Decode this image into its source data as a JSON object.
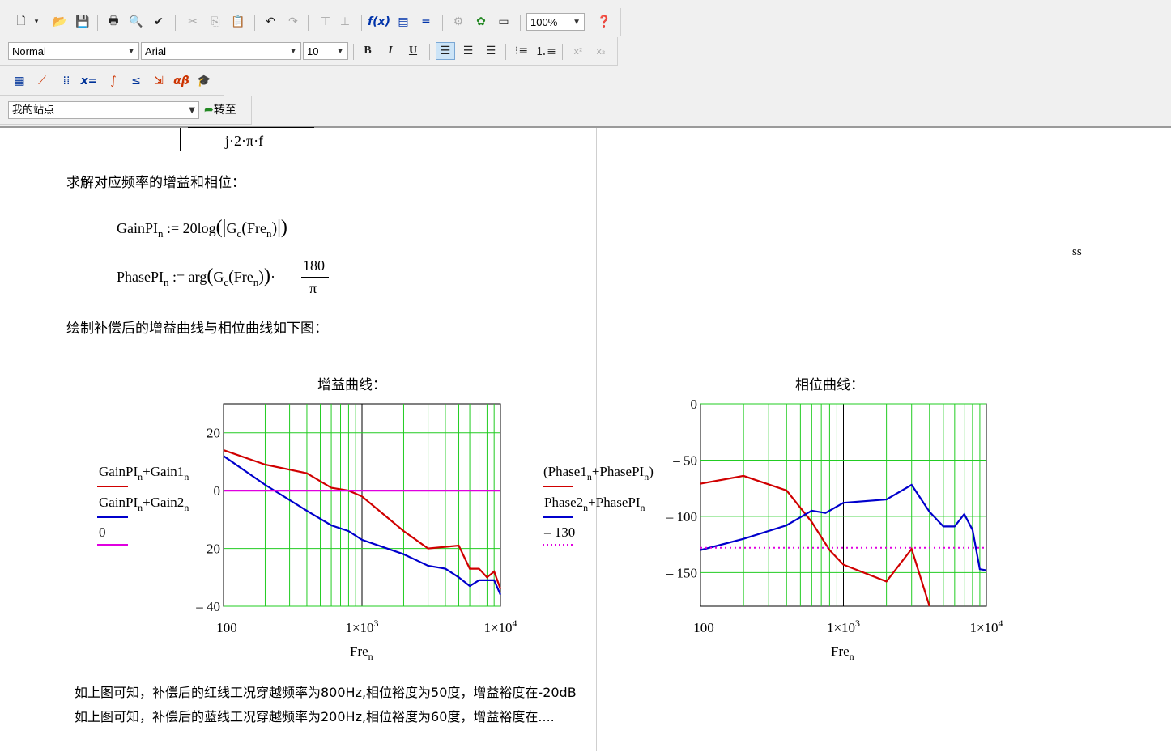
{
  "toolbar": {
    "zoom": "100%",
    "style": "Normal",
    "font": "Arial",
    "size": "10",
    "bold": "B",
    "italic": "I",
    "underline": "U",
    "sites": "我的站点",
    "goto": "转至"
  },
  "doc": {
    "fraction_den": "j·2·π·f",
    "heading1": "求解对应频率的增益和相位：",
    "eq1_lhs": "GainPI",
    "eq1_rhs": "20log",
    "eq1_fn": "G",
    "eq1_arg": "Fre",
    "eq2_lhs": "PhasePI",
    "eq2_rhs": "arg",
    "eq2_num": "180",
    "eq2_den": "π",
    "heading2": "绘制补偿后的增益曲线与相位曲线如下图：",
    "stray": "ss",
    "conclusion1": "如上图可知，补偿后的红线工况穿越频率为800Hz,相位裕度为50度，增益裕度在-20dB",
    "conclusion2": "如上图可知，补偿后的蓝线工况穿越频率为200Hz,相位裕度为60度，增益裕度在...."
  },
  "chart_data": [
    {
      "type": "line",
      "title": "增益曲线：",
      "xlabel": "Fre",
      "xscale": "log",
      "xlim": [
        100,
        10000
      ],
      "ylim": [
        -40,
        30
      ],
      "yticks": [
        "20",
        "0",
        "– 20",
        "– 40"
      ],
      "xticks": [
        "100",
        "1×10",
        "1×10"
      ],
      "xtick_exp": [
        "",
        "3",
        "4"
      ],
      "series": [
        {
          "name": "GainPI+Gain1",
          "color": "#d00000",
          "x": [
            100,
            200,
            400,
            600,
            800,
            1000,
            2000,
            3000,
            5000,
            6000,
            7000,
            8000,
            9000,
            10000
          ],
          "y": [
            14,
            9,
            6,
            1,
            0,
            -2,
            -14,
            -20,
            -19,
            -27,
            -27,
            -30,
            -28,
            -34
          ]
        },
        {
          "name": "GainPI+Gain2",
          "color": "#0000cc",
          "x": [
            100,
            200,
            400,
            600,
            800,
            1000,
            2000,
            3000,
            4000,
            5000,
            6000,
            7000,
            8000,
            9000,
            10000
          ],
          "y": [
            12,
            2,
            -7,
            -12,
            -14,
            -17,
            -22,
            -26,
            -27,
            -30,
            -33,
            -31,
            -31,
            -31,
            -36
          ]
        },
        {
          "name": "0",
          "color": "#e000e0",
          "x": [
            100,
            10000
          ],
          "y": [
            0,
            0
          ]
        }
      ]
    },
    {
      "type": "line",
      "title": "相位曲线：",
      "xlabel": "Fre",
      "xscale": "log",
      "xlim": [
        100,
        10000
      ],
      "ylim": [
        -180,
        0
      ],
      "yticks": [
        "0",
        "– 50",
        "– 100",
        "– 150"
      ],
      "xticks": [
        "100",
        "1×10",
        "1×10"
      ],
      "xtick_exp": [
        "",
        "3",
        "4"
      ],
      "series": [
        {
          "name": "(Phase1+PhasePI)",
          "color": "#d00000",
          "x": [
            100,
            200,
            400,
            600,
            800,
            1000,
            2000,
            3000,
            4000
          ],
          "y": [
            -71,
            -64,
            -77,
            -105,
            -130,
            -143,
            -158,
            -129,
            -180
          ]
        },
        {
          "name": "Phase2+PhasePI",
          "color": "#0000cc",
          "x": [
            100,
            200,
            400,
            600,
            750,
            1000,
            2000,
            3000,
            4000,
            5000,
            6000,
            7000,
            8000,
            9000,
            10000
          ],
          "y": [
            -130,
            -120,
            -108,
            -95,
            -97,
            -88,
            -85,
            -72,
            -96,
            -109,
            -109,
            -98,
            -112,
            -147,
            -148
          ]
        },
        {
          "name": "– 130",
          "color": "#e000e0",
          "x": [
            100,
            10000
          ],
          "y": [
            -128,
            -128
          ]
        }
      ]
    }
  ]
}
